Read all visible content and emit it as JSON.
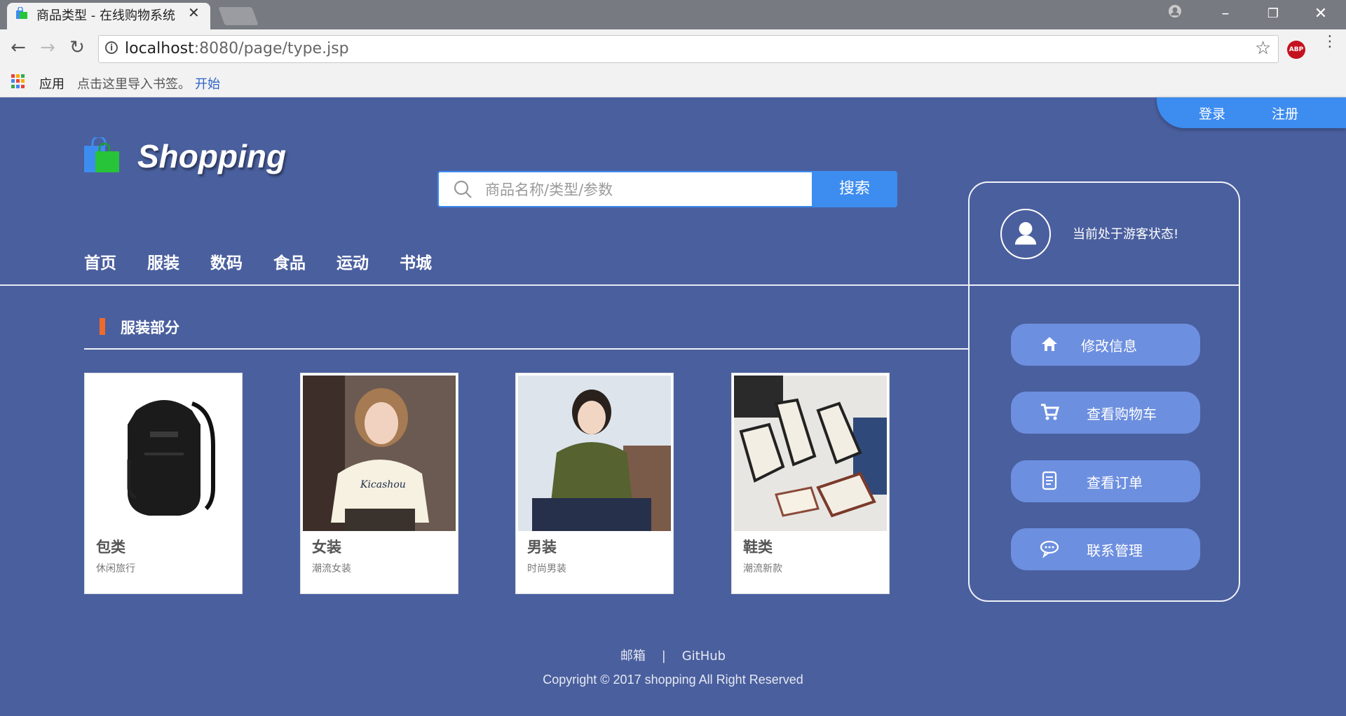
{
  "browser": {
    "tab_title": "商品类型 - 在线购物系统",
    "url_host": "localhost",
    "url_rest": ":8080/page/type.jsp",
    "bookmark_apps": "应用",
    "bookmark_import": "点击这里导入书签。",
    "bookmark_start": "开始"
  },
  "header": {
    "login": "登录",
    "register": "注册",
    "logo_text": "Shopping",
    "search_placeholder": "商品名称/类型/参数",
    "search_button": "搜索"
  },
  "nav": {
    "items": [
      {
        "label": "首页"
      },
      {
        "label": "服装"
      },
      {
        "label": "数码"
      },
      {
        "label": "食品"
      },
      {
        "label": "运动"
      },
      {
        "label": "书城"
      }
    ]
  },
  "section": {
    "title": "服装部分"
  },
  "products": [
    {
      "title": "包类",
      "subtitle": "休闲旅行"
    },
    {
      "title": "女装",
      "subtitle": "潮流女装"
    },
    {
      "title": "男装",
      "subtitle": "时尚男装"
    },
    {
      "title": "鞋类",
      "subtitle": "潮流新款"
    }
  ],
  "sidebar": {
    "status": "当前处于游客状态!",
    "buttons": [
      {
        "label": "修改信息",
        "icon": "home-icon"
      },
      {
        "label": "查看购物车",
        "icon": "cart-icon"
      },
      {
        "label": "查看订单",
        "icon": "document-icon"
      },
      {
        "label": "联系管理",
        "icon": "chat-icon"
      }
    ]
  },
  "footer": {
    "mail": "邮箱",
    "separator": "|",
    "github": "GitHub",
    "copyright": "Copyright © 2017 shopping All Right Reserved"
  },
  "colors": {
    "page_bg": "#4a5f9e",
    "accent_blue": "#3d8cf0",
    "side_button": "#6d8fdf",
    "section_marker": "#f06a2a"
  }
}
